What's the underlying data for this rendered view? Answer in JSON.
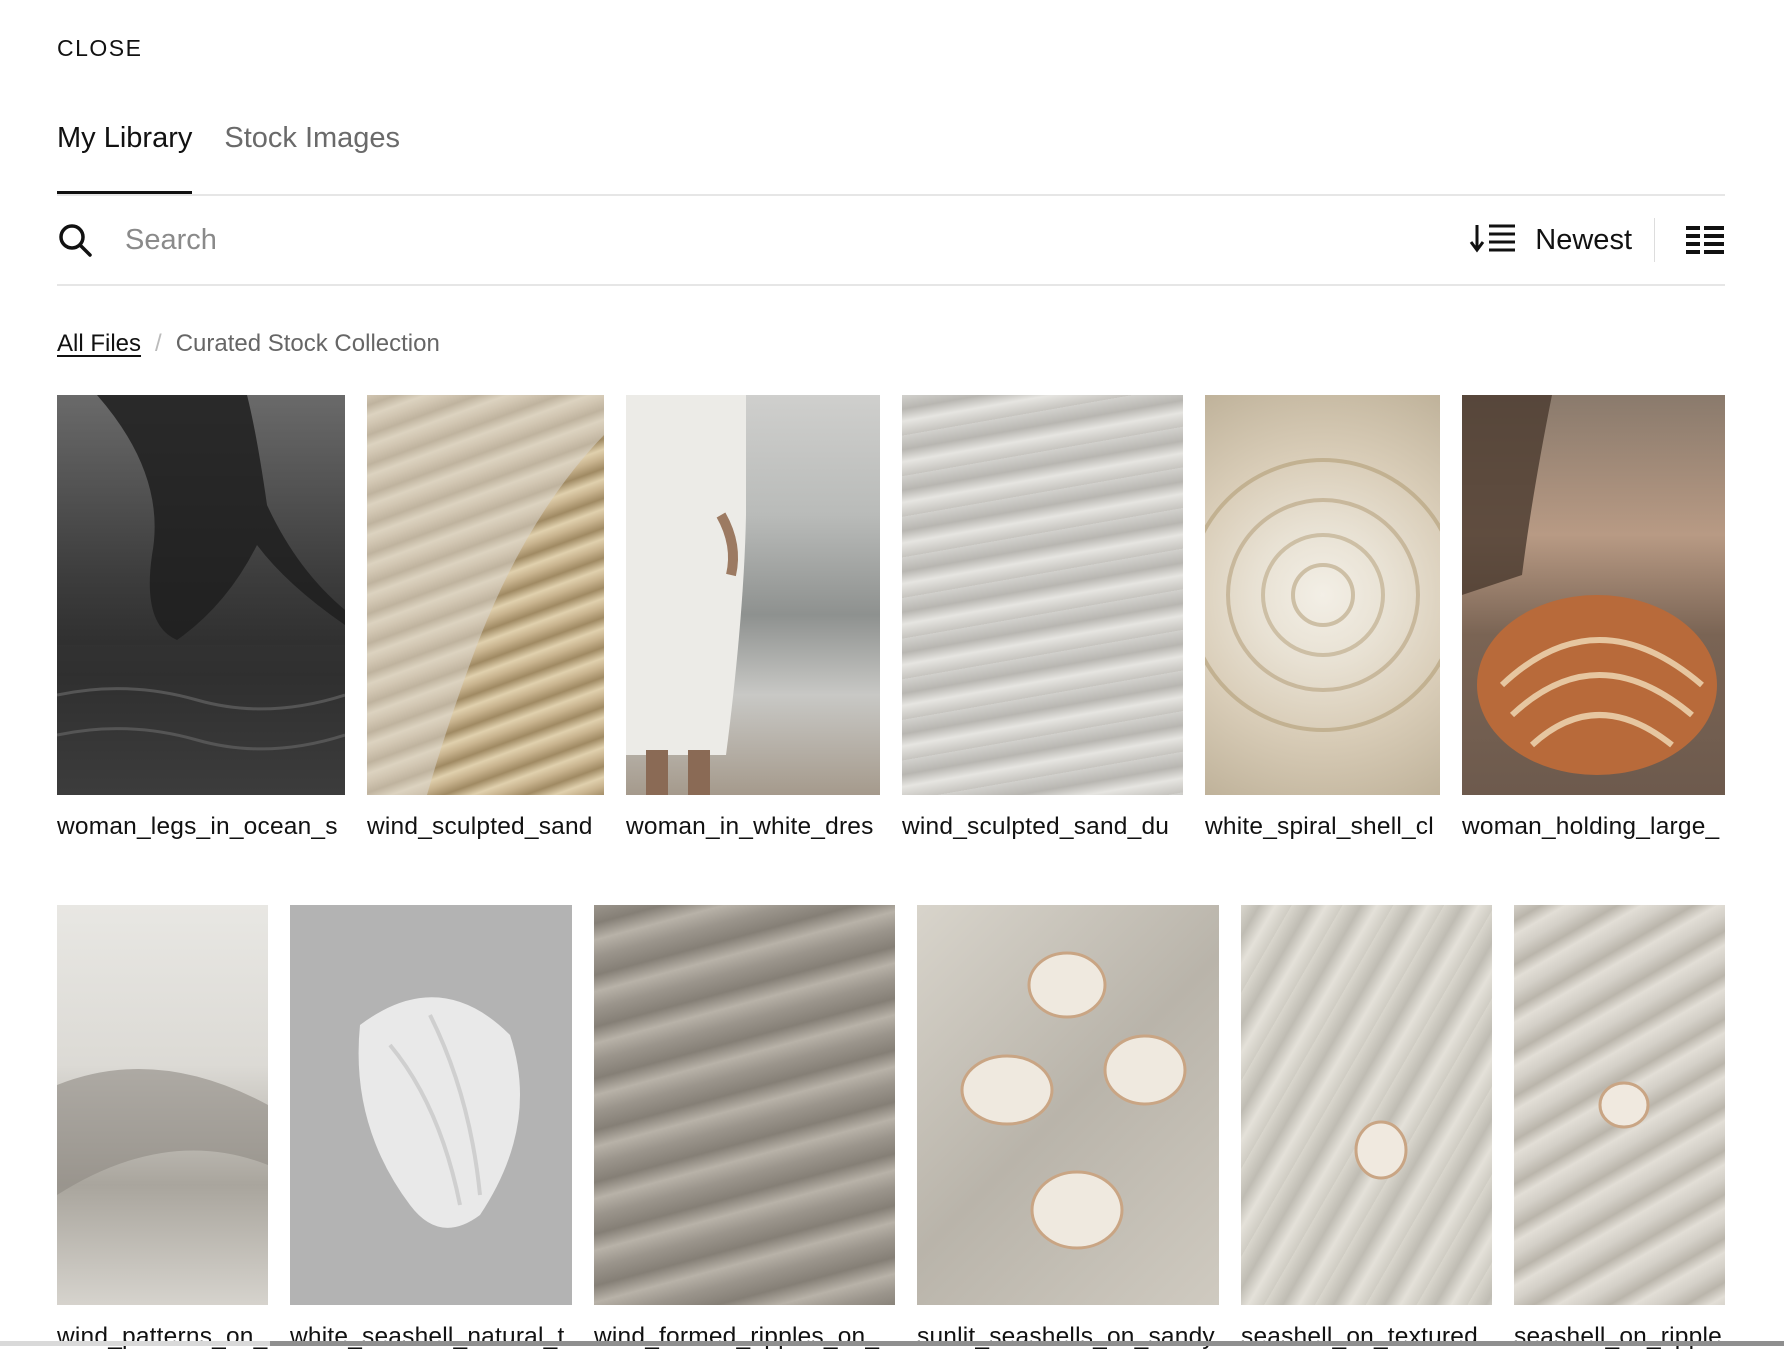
{
  "header": {
    "close_label": "CLOSE"
  },
  "tabs": [
    {
      "label": "My Library",
      "active": true
    },
    {
      "label": "Stock Images",
      "active": false
    }
  ],
  "search": {
    "placeholder": "Search",
    "value": ""
  },
  "sort": {
    "label": "Newest",
    "icon": "sort-descending-icon"
  },
  "view_toggle": {
    "icon": "list-view-icon"
  },
  "breadcrumb": {
    "root": "All Files",
    "separator": "/",
    "current": "Curated Stock Collection"
  },
  "rows": [
    [
      {
        "caption": "woman_legs_in_ocean_s"
      },
      {
        "caption": "wind_sculpted_sand"
      },
      {
        "caption": "woman_in_white_dres"
      },
      {
        "caption": "wind_sculpted_sand_du"
      },
      {
        "caption": "white_spiral_shell_cl"
      },
      {
        "caption": "woman_holding_large_"
      }
    ],
    [
      {
        "caption": "wind_patterns_on_"
      },
      {
        "caption": "white_seashell_natural_t"
      },
      {
        "caption": "wind_formed_ripples_on_"
      },
      {
        "caption": "sunlit_seashells_on_sandy"
      },
      {
        "caption": "seashell_on_textured"
      },
      {
        "caption": "seashell_on_ripple"
      }
    ]
  ]
}
